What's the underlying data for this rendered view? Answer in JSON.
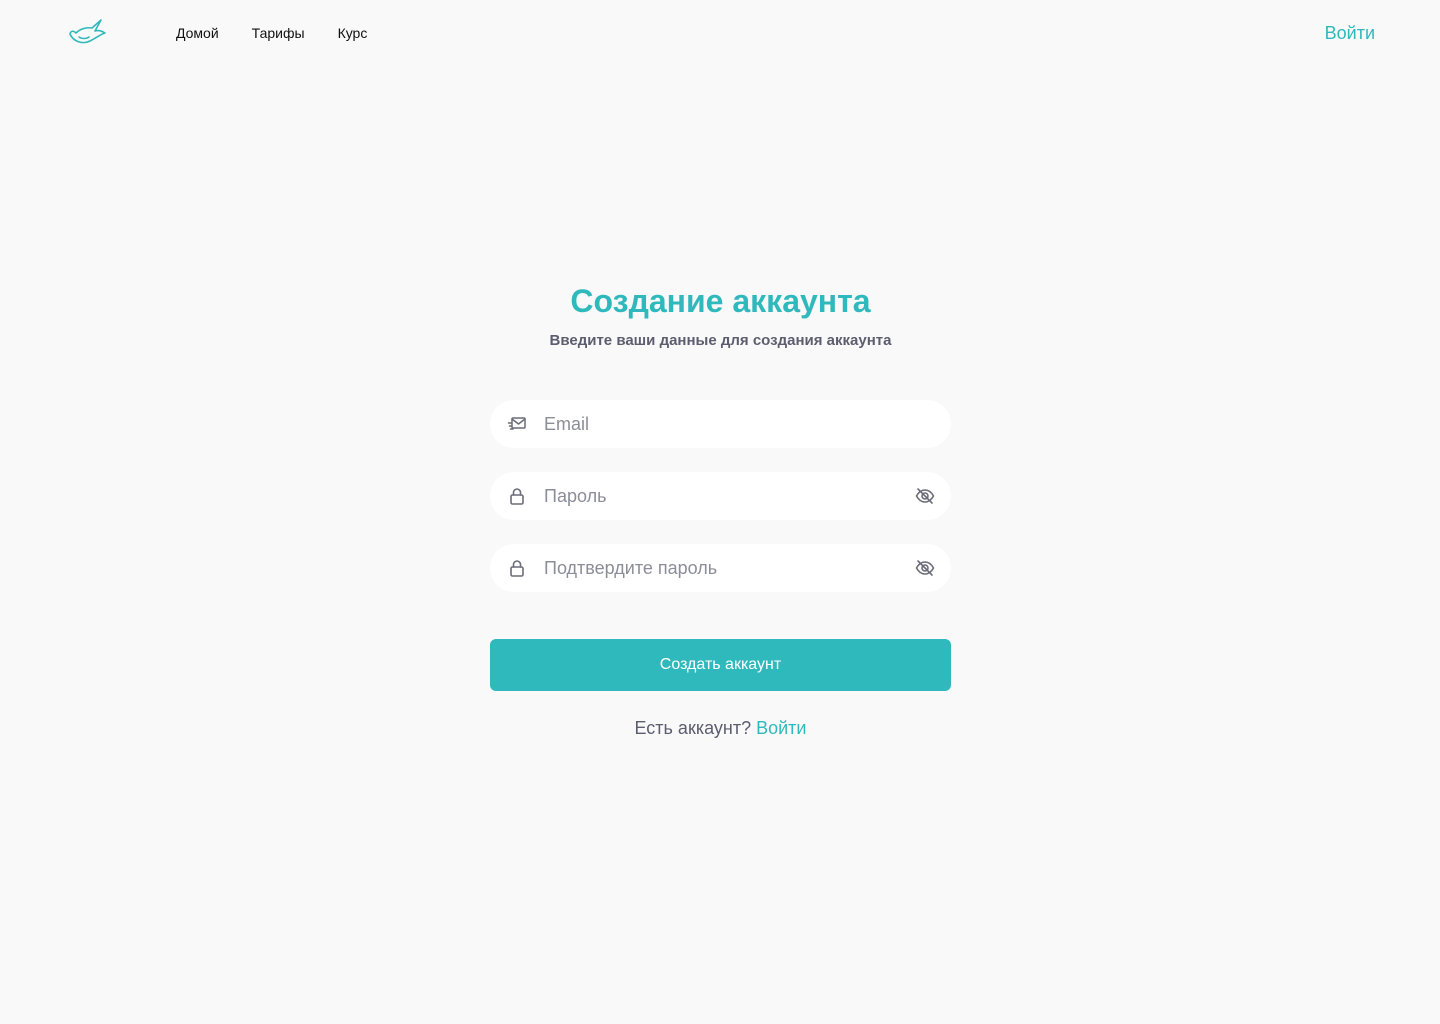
{
  "header": {
    "logo_icon": "bird-logo-icon",
    "nav": [
      {
        "label": "Домой"
      },
      {
        "label": "Тарифы"
      },
      {
        "label": "Курс"
      }
    ],
    "login_label": "Войти"
  },
  "form": {
    "title": "Создание аккаунта",
    "subtitle": "Введите ваши данные для создания аккаунта",
    "email": {
      "placeholder": "Email",
      "value": "",
      "icon": "mail-icon"
    },
    "password": {
      "placeholder": "Пароль",
      "value": "",
      "icon": "lock-icon",
      "toggle_icon": "eye-off-icon"
    },
    "confirm": {
      "placeholder": "Подтвердите пароль",
      "value": "",
      "icon": "lock-icon",
      "toggle_icon": "eye-off-icon"
    },
    "submit_label": "Создать аккаунт",
    "has_account_text": "Есть аккаунт?",
    "login_link": "Войти"
  },
  "colors": {
    "accent": "#30b9bc",
    "background": "#f9f9f9",
    "muted_text": "#5c5d6e",
    "placeholder": "#8c8d98"
  }
}
